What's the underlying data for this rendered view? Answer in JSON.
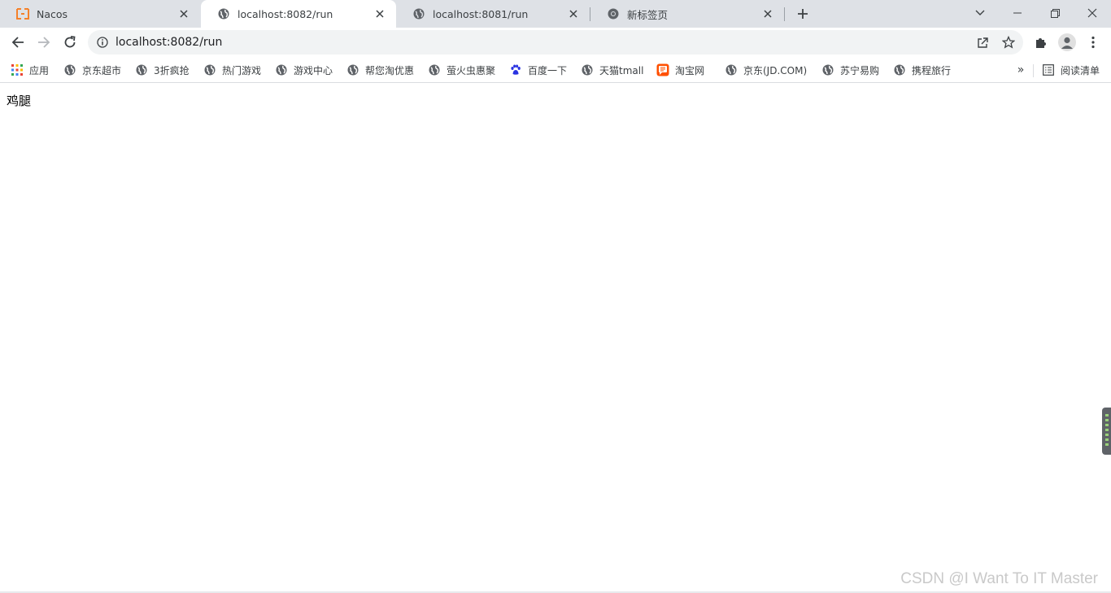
{
  "browser": {
    "tabs": [
      {
        "title": "Nacos",
        "favicon": "nacos-icon",
        "active": false
      },
      {
        "title": "localhost:8082/run",
        "favicon": "globe-icon",
        "active": true
      },
      {
        "title": "localhost:8081/run",
        "favicon": "globe-icon",
        "active": false
      },
      {
        "title": "新标签页",
        "favicon": "chrome-icon",
        "active": false
      }
    ],
    "address": "localhost:8082/run",
    "colors": {
      "tabstrip": "#dee1e6",
      "omnibox": "#f1f3f4",
      "nacos_orange": "#f5812a"
    }
  },
  "bookmarks": {
    "items": [
      {
        "label": "应用",
        "icon": "apps-grid-icon"
      },
      {
        "label": "京东超市",
        "icon": "globe-icon"
      },
      {
        "label": "3折疯抢",
        "icon": "globe-icon"
      },
      {
        "label": "热门游戏",
        "icon": "globe-icon"
      },
      {
        "label": "游戏中心",
        "icon": "globe-icon"
      },
      {
        "label": "帮您淘优惠",
        "icon": "globe-icon"
      },
      {
        "label": "萤火虫惠聚",
        "icon": "globe-icon"
      },
      {
        "label": "百度一下",
        "icon": "baidu-paw-icon"
      },
      {
        "label": "天猫tmall",
        "icon": "globe-icon"
      },
      {
        "label": "淘宝网",
        "icon": "taobao-icon"
      },
      {
        "label": "京东(JD.COM)",
        "icon": "globe-icon"
      },
      {
        "label": "苏宁易购",
        "icon": "globe-icon"
      },
      {
        "label": "携程旅行",
        "icon": "globe-icon"
      }
    ],
    "more": "»",
    "reading_list": "阅读清单"
  },
  "page": {
    "content": "鸡腿"
  },
  "watermark": "CSDN @I Want To IT Master"
}
